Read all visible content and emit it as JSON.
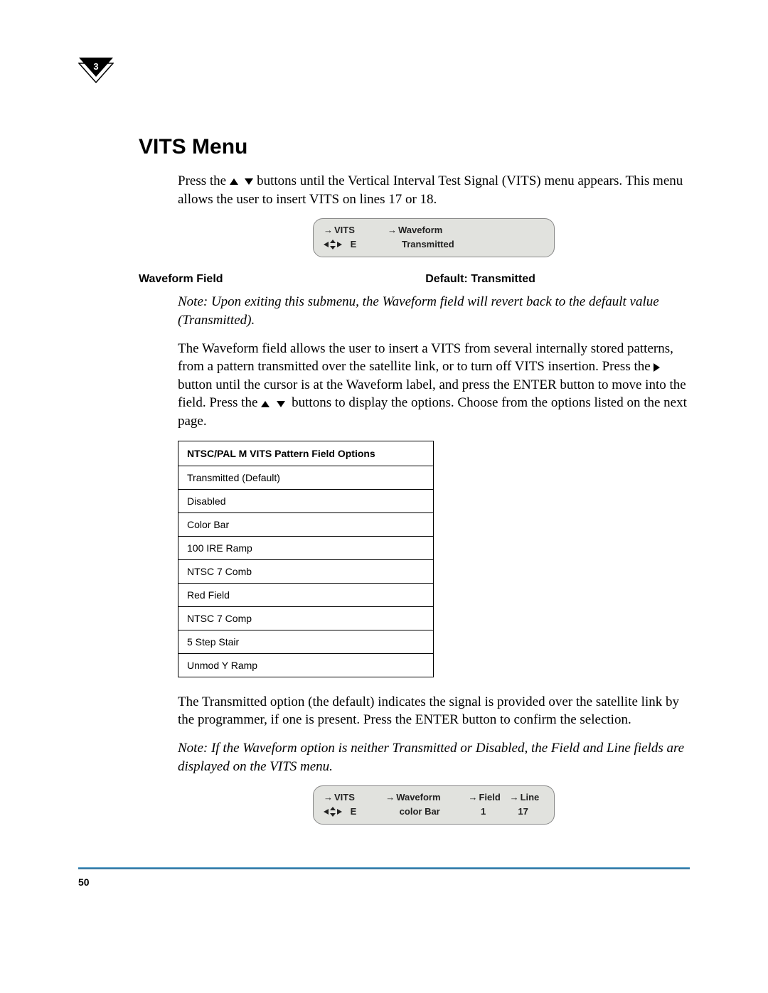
{
  "chapter_badge": "3",
  "section_title": "VITS Menu",
  "intro_before": "Press the ",
  "intro_after": " buttons until the Vertical Interval Test Signal (VITS) menu appears. This menu allows the user to insert VITS on lines 17 or 18.",
  "lcd1": {
    "menu": "VITS",
    "field1": "Waveform",
    "nav": "E",
    "value1": "Transmitted"
  },
  "field_header": {
    "left": "Waveform Field",
    "right": "Default: Transmitted"
  },
  "note1": "Note:   Upon exiting this submenu, the Waveform field will revert back to the default value (Transmitted).",
  "para2_before": "The Waveform field allows the user to insert a VITS from several internally stored patterns, from a pattern transmitted over the satellite link, or to turn off VITS insertion. Press the ",
  "para2_mid1": " button until the cursor is at the Waveform label, and press the ENTER button to move into the field. Press the ",
  "para2_after": " buttons to display the options. Choose from the options listed on the next page.",
  "table": {
    "header": "NTSC/PAL M VITS Pattern Field Options",
    "rows": [
      "Transmitted (Default)",
      "Disabled",
      "Color Bar",
      "100 IRE Ramp",
      "NTSC 7 Comb",
      "Red Field",
      "NTSC 7 Comp",
      "5 Step Stair",
      "Unmod Y Ramp"
    ]
  },
  "para3": "The Transmitted option (the default) indicates the signal is provided over the satellite link by the programmer, if one is present. Press the ENTER button to confirm the selection.",
  "note2": "Note:   If the Waveform option is neither Transmitted or Disabled, the Field and Line fields are displayed on the VITS menu.",
  "lcd2": {
    "menu": "VITS",
    "field1": "Waveform",
    "field2": "Field",
    "field3": "Line",
    "nav": "E",
    "value1": "color Bar",
    "value2": "1",
    "value3": "17"
  },
  "page_number": "50"
}
